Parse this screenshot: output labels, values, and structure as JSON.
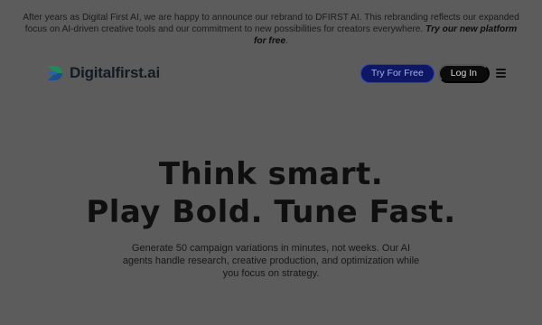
{
  "announcement": {
    "text": "After years as Digital First AI, we are happy to announce our rebrand to DFIRST AI. This rebranding reflects our expanded focus on AI-driven creative tools and our commitment to new possibilities for creators everywhere.",
    "cta": "Try our new platform for free",
    "cta_suffix": "."
  },
  "nav": {
    "logo_icon": "digitalfirst-logo-mark",
    "logo_text": "Digitalfirst.ai",
    "try_label": "Try For Free",
    "login_label": "Log In",
    "menu_icon": "hamburger-menu-icon"
  },
  "hero": {
    "title_line1": "Think smart.",
    "title_line2": "Play Bold. Tune Fast.",
    "subtitle": "Generate 50 campaign variations in minutes, not weeks. Our AI agents handle research, creative production, and optimization while you focus on strategy."
  },
  "colors": {
    "overlay_background": "#5c5c5c",
    "try_button": "#0e1763",
    "login_button": "#0b0b0b",
    "logo_green": "#1f8a5a",
    "logo_blue": "#1d4f8f"
  }
}
